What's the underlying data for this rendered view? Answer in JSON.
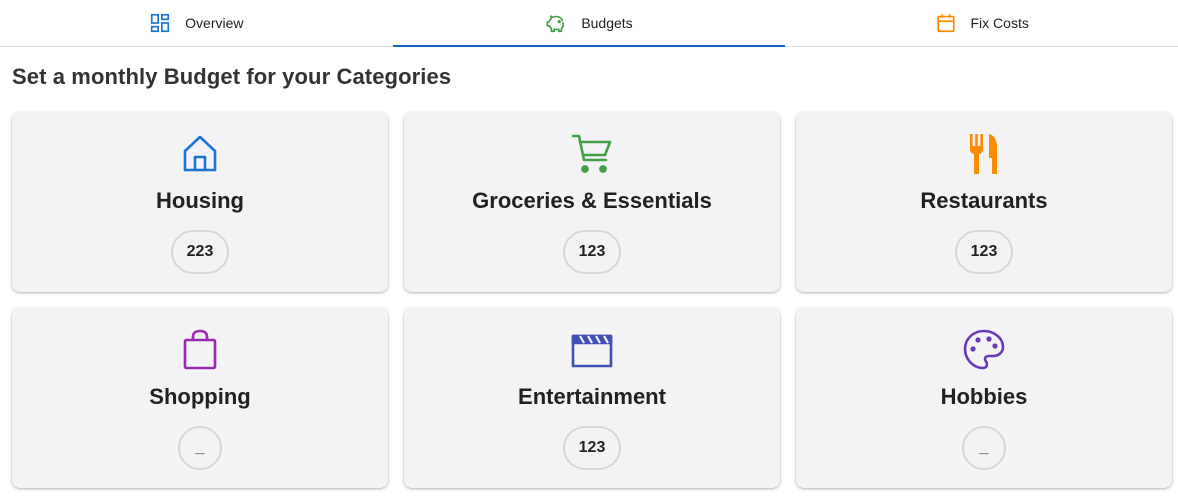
{
  "tabs": [
    {
      "label": "Overview",
      "icon": "dashboard-icon",
      "color": "#1976d2",
      "active": false
    },
    {
      "label": "Budgets",
      "icon": "piggy-bank-icon",
      "color": "#43a047",
      "active": true
    },
    {
      "label": "Fix Costs",
      "icon": "calendar-icon",
      "color": "#fb8c00",
      "active": false
    }
  ],
  "page": {
    "title": "Set a monthly Budget for your Categories"
  },
  "categories": [
    {
      "name": "Housing",
      "icon": "house-icon",
      "color": "#1976d2",
      "budget": "223"
    },
    {
      "name": "Groceries & Essentials",
      "icon": "shopping-cart-icon",
      "color": "#43a047",
      "budget": "123"
    },
    {
      "name": "Restaurants",
      "icon": "restaurant-icon",
      "color": "#fb8c00",
      "budget": "123"
    },
    {
      "name": "Shopping",
      "icon": "shopping-bag-icon",
      "color": "#9c27b0",
      "budget": "_"
    },
    {
      "name": "Entertainment",
      "icon": "clapperboard-icon",
      "color": "#3f51b5",
      "budget": "123"
    },
    {
      "name": "Hobbies",
      "icon": "palette-icon",
      "color": "#673ab7",
      "budget": "_"
    }
  ]
}
